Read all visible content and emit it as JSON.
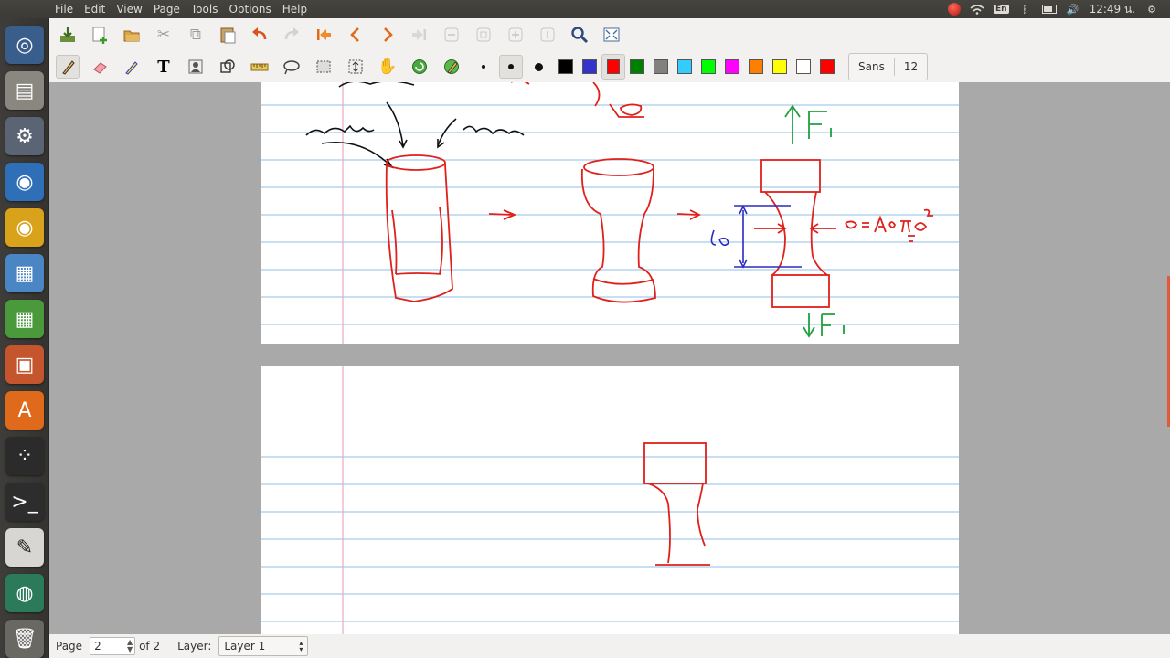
{
  "menubar": {
    "items": [
      "File",
      "Edit",
      "View",
      "Page",
      "Tools",
      "Options",
      "Help"
    ],
    "keyboard_layout": "En",
    "clock": "12:49 น."
  },
  "launcher": {
    "items": [
      "ubuntu-dash-icon",
      "files-icon",
      "settings-icon",
      "chromium-icon",
      "chrome-icon",
      "document-viewer-icon",
      "spreadsheet-icon",
      "presentation-icon",
      "software-center-icon",
      "screen-recorder-icon",
      "terminal-icon",
      "xournal-icon",
      "earth-icon",
      "trash-icon"
    ]
  },
  "toolbar1": {
    "icons": [
      "save-icon",
      "new-page-icon",
      "open-icon",
      "cut-icon",
      "copy-icon",
      "paste-icon",
      "undo-icon",
      "redo-icon",
      "first-page-icon",
      "previous-page-icon",
      "next-page-icon",
      "last-page-icon",
      "zoom-out-icon",
      "zoom-fit-icon",
      "zoom-in-icon",
      "zoom-100-icon",
      "find-icon",
      "fullscreen-icon"
    ]
  },
  "toolbar2": {
    "tools": [
      "pen-icon",
      "eraser-icon",
      "highlighter-icon",
      "text-icon",
      "image-icon",
      "shape-recognizer-icon",
      "ruler-icon",
      "lasso-select-icon",
      "rect-select-icon",
      "vertical-space-icon",
      "hand-icon",
      "default-tool-icon",
      "pen-settings-icon"
    ],
    "colors": [
      "#000000",
      "#3333cc",
      "#ff0000",
      "#008000",
      "#808080",
      "#33ccff",
      "#00ff00",
      "#ff00ff",
      "#ff8000",
      "#ffff00",
      "#ffffff",
      "#ff0000"
    ],
    "active_color_index": 2,
    "font_name": "Sans",
    "font_size": "12"
  },
  "statusbar": {
    "page_label": "Page",
    "page_value": "2",
    "page_total": "of 2",
    "layer_label": "Layer:",
    "layer_value": "Layer 1"
  }
}
